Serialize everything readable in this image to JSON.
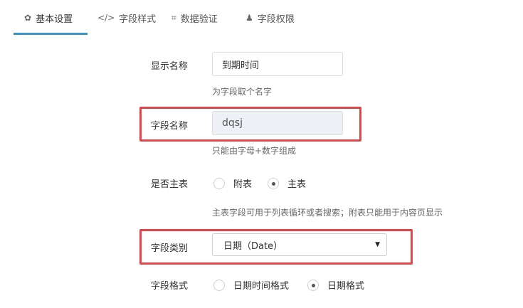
{
  "tabs": [
    {
      "icon": "gear-icon",
      "glyph": "✿",
      "label": "基本设置",
      "active": true
    },
    {
      "icon": "code-icon",
      "glyph": "</>",
      "label": "字段样式",
      "active": false
    },
    {
      "icon": "crop-icon",
      "glyph": "⌗",
      "label": "数据验证",
      "active": false
    },
    {
      "icon": "user-icon",
      "glyph": "♟",
      "label": "字段权限",
      "active": false
    }
  ],
  "form": {
    "display_name": {
      "label": "显示名称",
      "value": "到期时间",
      "help": "为字段取个名字"
    },
    "field_name": {
      "label": "字段名称",
      "value": "dqsj",
      "help": "只能由字母+数字组成"
    },
    "is_main_table": {
      "label": "是否主表",
      "options": [
        {
          "label": "附表",
          "checked": false
        },
        {
          "label": "主表",
          "checked": true
        }
      ],
      "help": "主表字段可用于列表循环或者搜索；附表只能用于内容页显示"
    },
    "field_type": {
      "label": "字段类别",
      "value": "日期（Date）"
    },
    "field_format": {
      "label": "字段格式",
      "options": [
        {
          "label": "日期时间格式",
          "checked": false
        },
        {
          "label": "日期格式",
          "checked": true
        }
      ]
    }
  },
  "colors": {
    "accent": "#3c95c9",
    "highlight": "#e0474b",
    "disabled_bg": "#edf0f4"
  }
}
